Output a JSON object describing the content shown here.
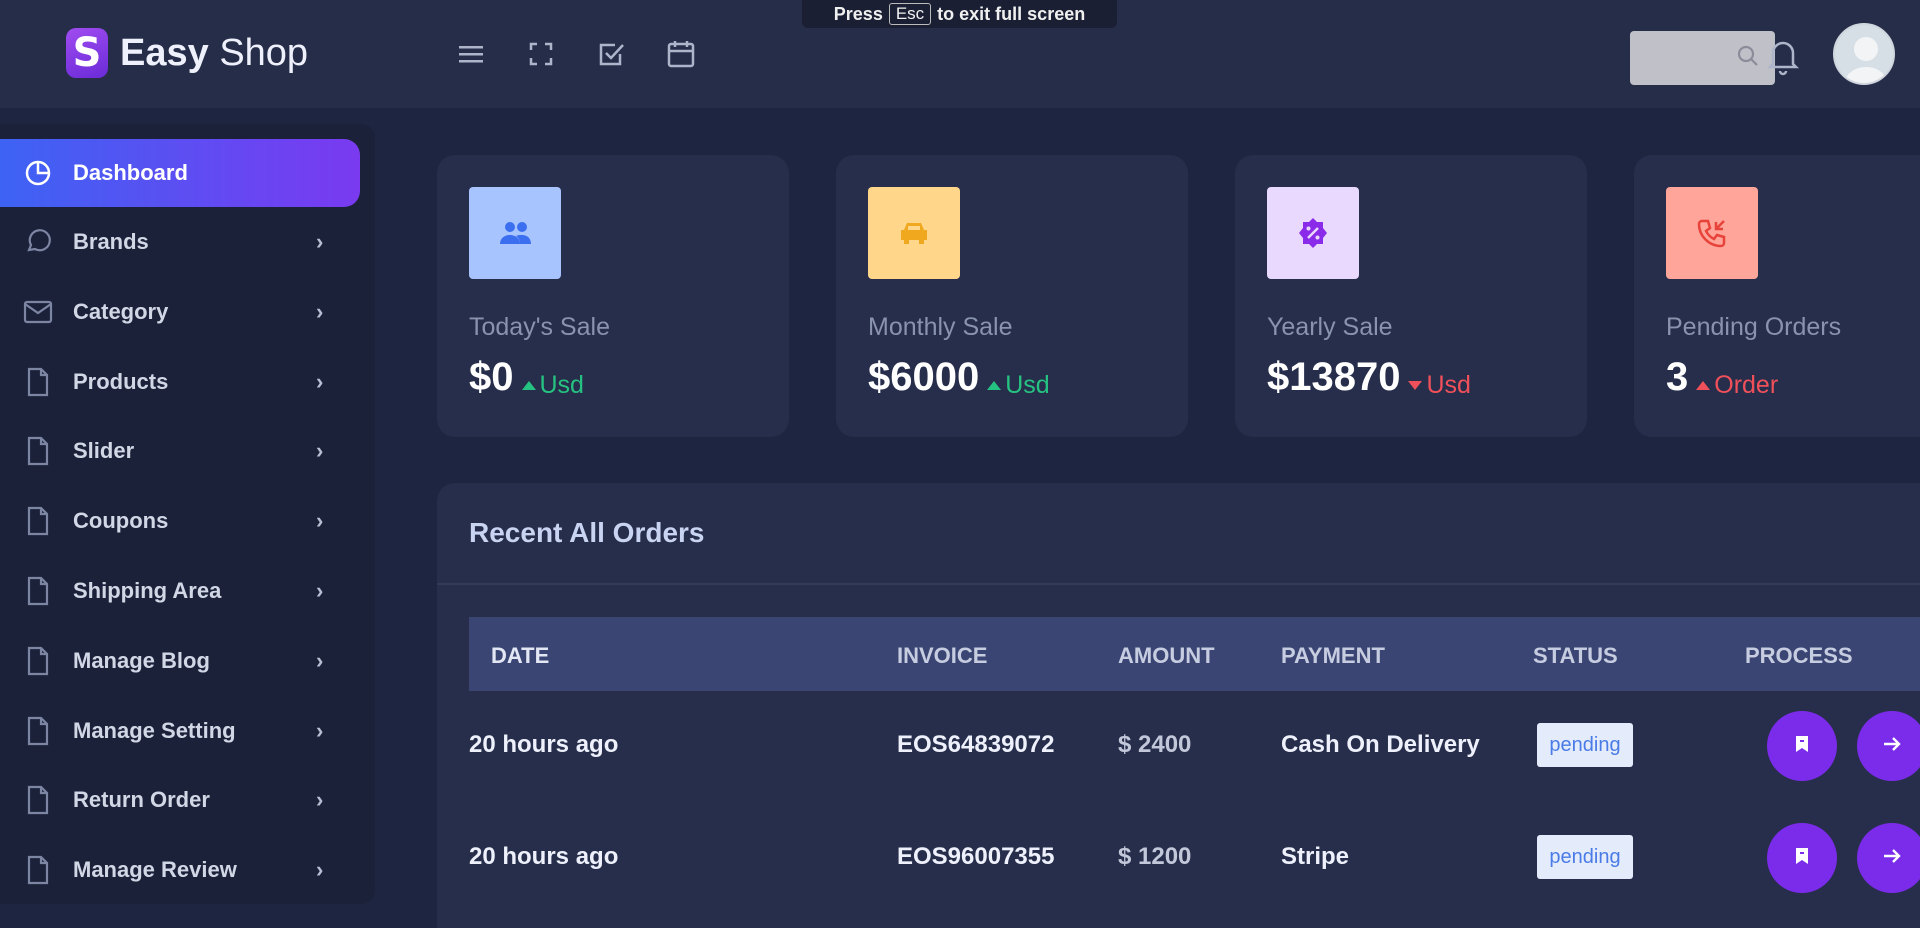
{
  "app": {
    "brand_strong": "Easy",
    "brand_light": "Shop",
    "logo_letter": "S"
  },
  "fullscreen_hint": {
    "prefix": "Press",
    "key": "Esc",
    "suffix": "to exit full screen"
  },
  "topbar": {
    "icons": [
      "menu-icon",
      "fullscreen-icon",
      "checkbox-icon",
      "calendar-icon"
    ],
    "search_placeholder": "",
    "notification_icon": "bell-icon"
  },
  "sidebar": {
    "items": [
      {
        "label": "Dashboard",
        "icon": "pie-chart-icon",
        "active": true
      },
      {
        "label": "Brands",
        "icon": "chat-icon"
      },
      {
        "label": "Category",
        "icon": "mail-icon"
      },
      {
        "label": "Products",
        "icon": "file-icon"
      },
      {
        "label": "Slider",
        "icon": "file-icon"
      },
      {
        "label": "Coupons",
        "icon": "file-icon"
      },
      {
        "label": "Shipping Area",
        "icon": "file-icon"
      },
      {
        "label": "Manage Blog",
        "icon": "file-icon"
      },
      {
        "label": "Manage Setting",
        "icon": "file-icon"
      },
      {
        "label": "Return Order",
        "icon": "file-icon"
      },
      {
        "label": "Manage Review",
        "icon": "file-icon"
      }
    ]
  },
  "stats": [
    {
      "label": "Today's Sale",
      "value": "$0",
      "unit": "Usd",
      "trend": "up",
      "icon": "users-icon",
      "box_color": "#a8c4ff",
      "icon_color": "#3b6ff0"
    },
    {
      "label": "Monthly Sale",
      "value": "$6000",
      "unit": "Usd",
      "trend": "up",
      "icon": "car-icon",
      "box_color": "#ffd68a",
      "icon_color": "#f0a81e"
    },
    {
      "label": "Yearly Sale",
      "value": "$13870",
      "unit": "Usd",
      "trend": "down",
      "icon": "discount-icon",
      "box_color": "#ead9ff",
      "icon_color": "#8a2bea"
    },
    {
      "label": "Pending Orders",
      "value": "3",
      "unit": "Order",
      "trend": "up",
      "icon": "phone-incoming-icon",
      "box_color": "#ffa59a",
      "icon_color": "#e8433a"
    }
  ],
  "orders": {
    "title": "Recent All Orders",
    "columns": [
      "DATE",
      "INVOICE",
      "AMOUNT",
      "PAYMENT",
      "STATUS",
      "PROCESS"
    ],
    "rows": [
      {
        "date": "20 hours ago",
        "invoice": "EOS64839072",
        "amount": "$ 2400",
        "payment": "Cash On Delivery",
        "status": "pending"
      },
      {
        "date": "20 hours ago",
        "invoice": "EOS96007355",
        "amount": "$ 1200",
        "payment": "Stripe",
        "status": "pending"
      }
    ]
  }
}
